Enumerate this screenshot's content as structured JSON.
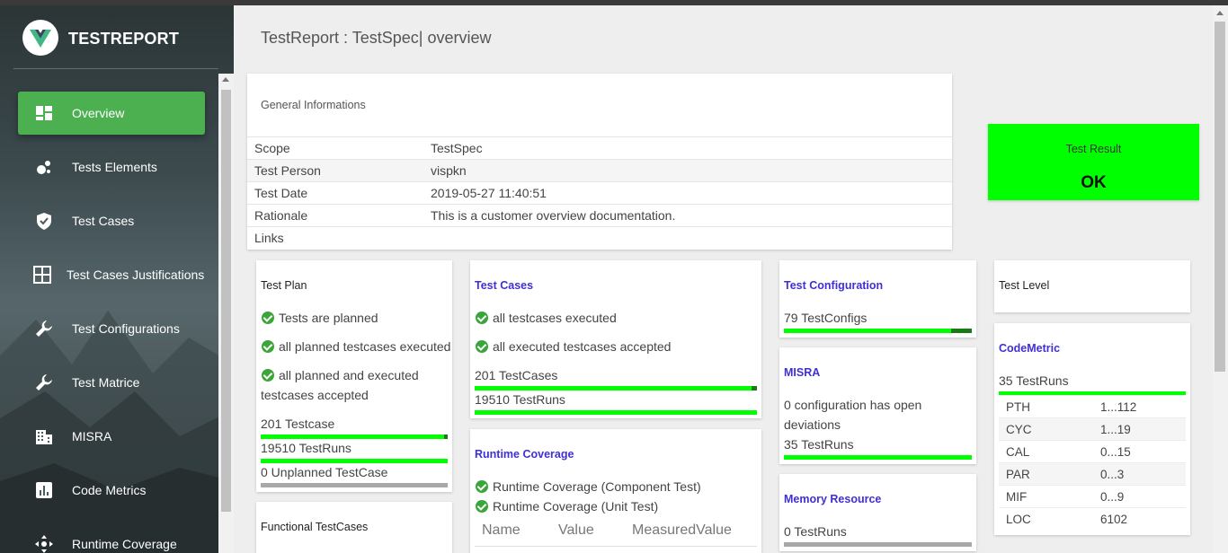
{
  "app": {
    "brand": "TESTREPORT"
  },
  "sidebar": {
    "items": [
      {
        "label": "Overview",
        "icon": "dashboard-icon",
        "active": true
      },
      {
        "label": "Tests Elements",
        "icon": "bubble-chart-icon"
      },
      {
        "label": "Test Cases",
        "icon": "verified-shield-icon"
      },
      {
        "label": "Test Cases Justifications",
        "icon": "grid-icon"
      },
      {
        "label": "Test Configurations",
        "icon": "wrench-icon"
      },
      {
        "label": "Test Matrice",
        "icon": "wrench-icon"
      },
      {
        "label": "MISRA",
        "icon": "building-icon"
      },
      {
        "label": "Code Metrics",
        "icon": "bar-chart-icon"
      },
      {
        "label": "Runtime Coverage",
        "icon": "move-icon"
      }
    ]
  },
  "header": {
    "title": "TestReport : TestSpec",
    "suffix": "| overview"
  },
  "general": {
    "title": "General Informations",
    "rows": [
      {
        "key": "Scope",
        "value": "TestSpec"
      },
      {
        "key": "Test Person",
        "value": "vispkn"
      },
      {
        "key": "Test Date",
        "value": "2019-05-27 11:40:51"
      },
      {
        "key": "Rationale",
        "value": "This is a customer overview documentation."
      },
      {
        "key": "Links",
        "value": ""
      }
    ]
  },
  "test_result": {
    "label": "Test Result",
    "value": "OK",
    "color": "#00ff00"
  },
  "test_plan": {
    "title": "Test Plan",
    "checks": [
      "Tests are planned",
      "all planned testcases executed",
      "all planned and executed",
      "testcases accepted"
    ],
    "testcase_count": "201 Testcase",
    "testcase_fraction": 0.98,
    "testruns": "19510 TestRuns",
    "testruns_fraction": 1.0,
    "unplanned": "0 Unplanned TestCase",
    "unplanned_fraction": 0
  },
  "functional": {
    "title": "Functional TestCases"
  },
  "test_cases": {
    "title": "Test Cases",
    "checks": [
      "all testcases executed",
      "all executed testcases accepted"
    ],
    "testcases": "201 TestCases",
    "testcases_fraction": 0.98,
    "testruns": "19510 TestRuns",
    "testruns_fraction": 1.0
  },
  "runtime_coverage": {
    "title": "Runtime Coverage",
    "checks": [
      "Runtime Coverage (Component Test)",
      "Runtime Coverage (Unit Test)"
    ],
    "columns": [
      "Name",
      "Value",
      "MeasuredValue"
    ]
  },
  "test_configuration": {
    "title": "Test Configuration",
    "count": "79 TestConfigs",
    "fraction": 0.89
  },
  "misra": {
    "title": "MISRA",
    "line1": "0 configuration has open",
    "line2": "deviations",
    "testruns": "35 TestRuns",
    "fraction": 1.0
  },
  "memory": {
    "title": "Memory Resource",
    "testruns": "0 TestRuns",
    "fraction": 0
  },
  "test_level": {
    "title": "Test Level"
  },
  "code_metric": {
    "title": "CodeMetric",
    "testruns": "35 TestRuns",
    "fraction": 1.0,
    "rows": [
      {
        "key": "PTH",
        "value": "1...112"
      },
      {
        "key": "CYC",
        "value": "1...19"
      },
      {
        "key": "CAL",
        "value": "0...15"
      },
      {
        "key": "PAR",
        "value": "0...3"
      },
      {
        "key": "MIF",
        "value": "0...9"
      },
      {
        "key": "LOC",
        "value": "6102"
      }
    ]
  },
  "colors": {
    "accent": "#4caf50",
    "progress": "#00ff00",
    "link": "#3f2fd8"
  }
}
